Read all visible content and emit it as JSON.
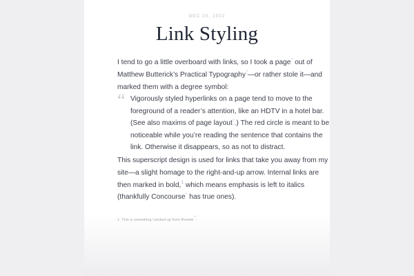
{
  "post": {
    "date": "DEC 20, 2022",
    "title": "Link Styling"
  },
  "para1": {
    "l1a": "I tend to go a little overboard with links, so I took a ",
    "link_page": "page",
    "l1b": " out of",
    "link_mb": "Matthew Butterick’s Practical Typography",
    "l2b": "—or rather stole it—and",
    "l3": "marked them with a degree symbol:"
  },
  "quote": {
    "mark": "“",
    "l1": "Vigorously styled hyperlinks on a page tend to move to the",
    "l2": "foreground of a reader’s attention, like an HDTV in a hotel bar.",
    "l3a": "(See also ",
    "link_maxims": "maxims of page layout",
    "l3b": ".) The red circle is meant to be",
    "l4": "noticeable while you’re reading the sentence that contains the",
    "l5": "link. Otherwise it disappears, so as not to distract."
  },
  "para2": {
    "l1": "This superscript design is used for links that take you away from my",
    "l2": "site—a slight homage to the right-and-up arrow. Internal links are",
    "l3a": "then marked in bold,",
    "l3b": " which means emphasis is left to italics",
    "l4a": "(thankfully ",
    "link_concourse": "Concourse",
    "l4b": " has true ones)."
  },
  "degree": "°",
  "footnote": {
    "text": "1. This is something I picked up from Reeder",
    "suffix": "."
  }
}
